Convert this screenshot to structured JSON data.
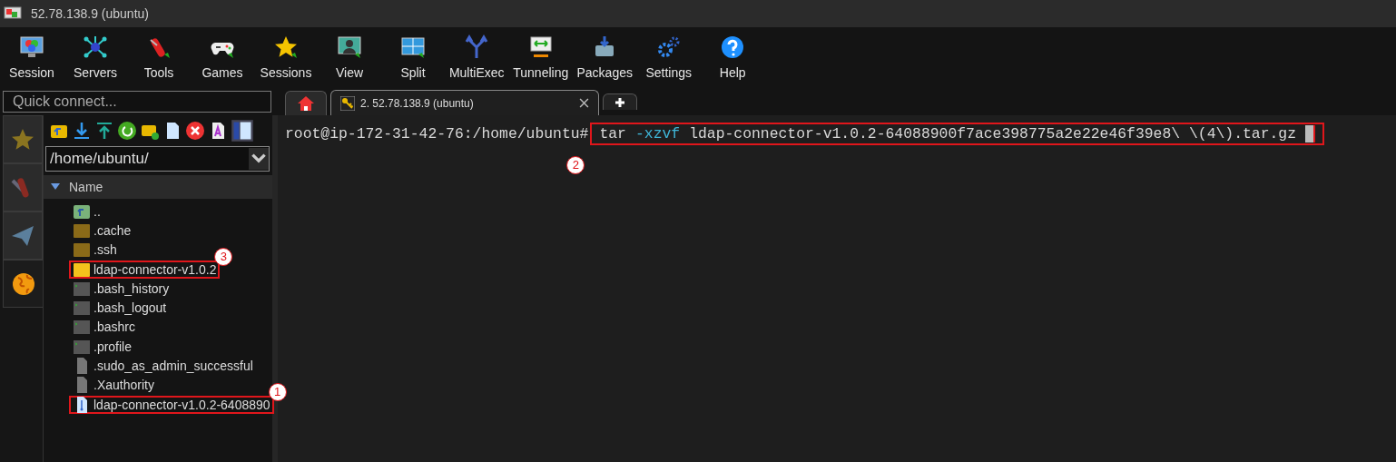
{
  "window": {
    "title": "52.78.138.9 (ubuntu)"
  },
  "toolbar": [
    {
      "label": "Session"
    },
    {
      "label": "Servers"
    },
    {
      "label": "Tools"
    },
    {
      "label": "Games"
    },
    {
      "label": "Sessions"
    },
    {
      "label": "View"
    },
    {
      "label": "Split"
    },
    {
      "label": "MultiExec"
    },
    {
      "label": "Tunneling"
    },
    {
      "label": "Packages"
    },
    {
      "label": "Settings"
    },
    {
      "label": "Help"
    }
  ],
  "quick_connect": {
    "placeholder": "Quick connect..."
  },
  "tabs": [
    {
      "kind": "home",
      "selected": false
    },
    {
      "kind": "session",
      "label": "2. 52.78.138.9 (ubuntu)",
      "selected": true
    },
    {
      "kind": "new",
      "selected": false
    }
  ],
  "side_tabs": [
    {
      "kind": "star",
      "selected": false
    },
    {
      "kind": "tools",
      "selected": false
    },
    {
      "kind": "send",
      "selected": false
    },
    {
      "kind": "globe",
      "selected": true
    }
  ],
  "file_browser": {
    "path": "/home/ubuntu/",
    "column": "Name",
    "items": [
      {
        "name": "..",
        "kind": "up"
      },
      {
        "name": ".cache",
        "kind": "folder"
      },
      {
        "name": ".ssh",
        "kind": "folder"
      },
      {
        "name": "ldap-connector-v1.0.2",
        "kind": "new-folder",
        "callout": {
          "number": "3"
        }
      },
      {
        "name": ".bash_history",
        "kind": "script"
      },
      {
        "name": ".bash_logout",
        "kind": "script"
      },
      {
        "name": ".bashrc",
        "kind": "script"
      },
      {
        "name": ".profile",
        "kind": "script"
      },
      {
        "name": ".sudo_as_admin_successful",
        "kind": "file"
      },
      {
        "name": ".Xauthority",
        "kind": "file"
      },
      {
        "name": "ldap-connector-v1.0.2-6408890",
        "kind": "archive",
        "callout": {
          "number": "1"
        }
      }
    ]
  },
  "terminal": {
    "prompt": "root@ip-172-31-42-76:/home/ubuntu#",
    "command": [
      {
        "kind": "program",
        "text": "tar"
      },
      {
        "kind": "option",
        "text": "-xzvf"
      },
      {
        "kind": "argument",
        "text": "ldap-connector-v1.0.2-64088900f7ace398775a2e22e46f39e8\\ \\(4\\).tar.gz"
      }
    ],
    "cursor": true,
    "callout": {
      "number": "2"
    }
  }
}
